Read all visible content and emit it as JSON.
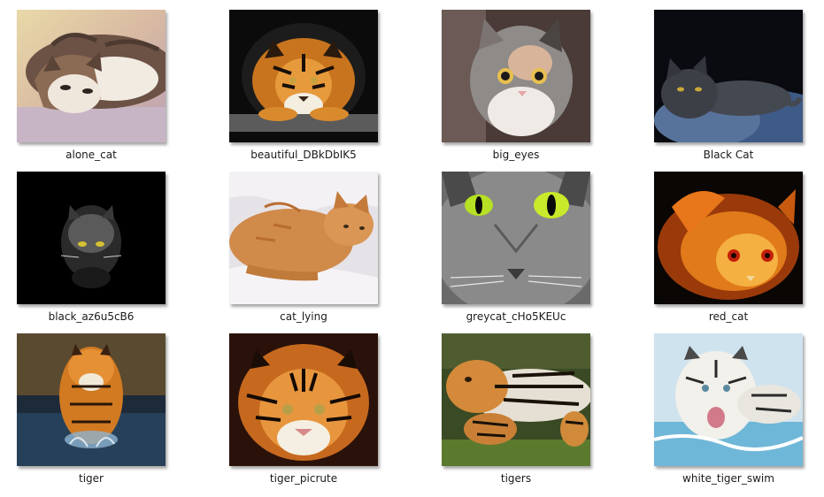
{
  "files": [
    {
      "name": "alone_cat",
      "icon": "cat-photo"
    },
    {
      "name": "beautiful_DBkDbIK5",
      "icon": "tiger-photo"
    },
    {
      "name": "big_eyes",
      "icon": "cat-photo"
    },
    {
      "name": "Black Cat",
      "icon": "cat-photo"
    },
    {
      "name": "black_az6u5cB6",
      "icon": "cat-photo"
    },
    {
      "name": "cat_lying",
      "icon": "cat-photo"
    },
    {
      "name": "greycat_cHo5KEUc",
      "icon": "cat-photo"
    },
    {
      "name": "red_cat",
      "icon": "cat-photo"
    },
    {
      "name": "tiger",
      "icon": "tiger-photo"
    },
    {
      "name": "tiger_picrute",
      "icon": "tiger-photo"
    },
    {
      "name": "tigers",
      "icon": "tiger-photo"
    },
    {
      "name": "white_tiger_swim",
      "icon": "tiger-photo"
    }
  ]
}
